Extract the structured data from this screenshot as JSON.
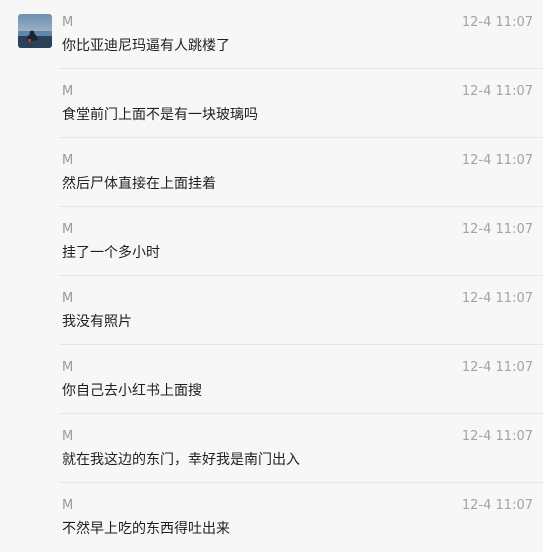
{
  "messages": [
    {
      "sender": "M",
      "time": "12-4 11:07",
      "text": "你比亚迪尼玛逼有人跳楼了",
      "show_avatar": true
    },
    {
      "sender": "M",
      "time": "12-4 11:07",
      "text": "食堂前门上面不是有一块玻璃吗",
      "show_avatar": false
    },
    {
      "sender": "M",
      "time": "12-4 11:07",
      "text": "然后尸体直接在上面挂着",
      "show_avatar": false
    },
    {
      "sender": "M",
      "time": "12-4 11:07",
      "text": "挂了一个多小时",
      "show_avatar": false
    },
    {
      "sender": "M",
      "time": "12-4 11:07",
      "text": "我没有照片",
      "show_avatar": false
    },
    {
      "sender": "M",
      "time": "12-4 11:07",
      "text": "你自己去小红书上面搜",
      "show_avatar": false
    },
    {
      "sender": "M",
      "time": "12-4 11:07",
      "text": "就在我这边的东门，幸好我是南门出入",
      "show_avatar": false
    },
    {
      "sender": "M",
      "time": "12-4 11:07",
      "text": "不然早上吃的东西得吐出来",
      "show_avatar": false
    }
  ],
  "colors": {
    "background": "#f7f7f7",
    "separator": "#e6e6e6",
    "sender_text": "#9a9a9a",
    "time_text": "#a3a3a3",
    "message_text": "#1f1f1f"
  }
}
